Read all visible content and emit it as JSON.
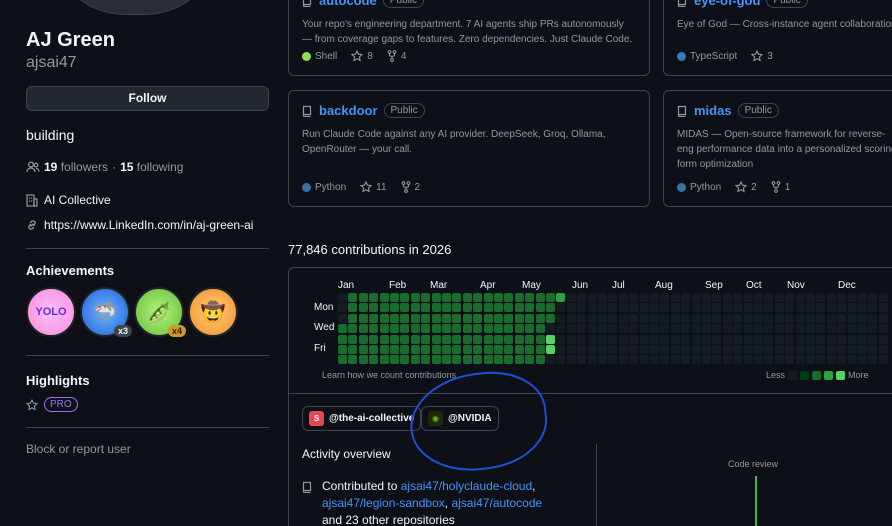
{
  "profile": {
    "name": "AJ Green",
    "login": "ajsai47",
    "follow_label": "Follow",
    "bio": "building",
    "followers_count": "19",
    "followers_label": "followers",
    "separator": "·",
    "following_count": "15",
    "following_label": "following",
    "org": "AI Collective",
    "url": "https://www.LinkedIn.com/in/aj-green-ai"
  },
  "achievements": {
    "title": "Achievements",
    "badges": [
      {
        "icon": "yolo-badge",
        "glyph": "YOLO",
        "count": ""
      },
      {
        "icon": "shark-badge",
        "glyph": "🦈",
        "count": "x3"
      },
      {
        "icon": "pair-extraordinaire-badge",
        "glyph": "🫛",
        "count": "x4"
      },
      {
        "icon": "quickdraw-badge",
        "glyph": "🤠",
        "count": ""
      }
    ]
  },
  "highlights": {
    "title": "Highlights",
    "pro": "PRO"
  },
  "block_label": "Block or report user",
  "repos": [
    {
      "name": "autocode",
      "visibility": "Public",
      "desc": "Your repo's engineering department. 7 AI agents ship PRs autonomously — from coverage gaps to features. Zero dependencies. Just Claude Code.",
      "language": "Shell",
      "lang_color": "#89e051",
      "stars": "8",
      "forks": "4"
    },
    {
      "name": "eye-of-god",
      "visibility": "Public",
      "desc": "Eye of God — Cross-instance agent collaboration",
      "language": "TypeScript",
      "lang_color": "#3178c6",
      "stars": "3",
      "forks": ""
    },
    {
      "name": "backdoor",
      "visibility": "Public",
      "desc": "Run Claude Code against any AI provider. DeepSeek, Groq, Ollama, OpenRouter — your call.",
      "language": "Python",
      "lang_color": "#3572A5",
      "stars": "11",
      "forks": "2"
    },
    {
      "name": "midas",
      "visibility": "Public",
      "desc": "MIDAS — Open-source framework for reverse-eng performance data into a personalized scoring form optimization",
      "language": "Python",
      "lang_color": "#3572A5",
      "stars": "2",
      "forks": "1"
    }
  ],
  "contributions": {
    "title": "77,846 contributions in 2026",
    "months": [
      "Jan",
      "Feb",
      "Mar",
      "Apr",
      "May",
      "Jun",
      "Jul",
      "Aug",
      "Sep",
      "Oct",
      "Nov",
      "Dec"
    ],
    "days": [
      "Mon",
      "Wed",
      "Fri"
    ],
    "learn_link": "Learn how we count contributions",
    "less": "Less",
    "more": "More",
    "filled_weeks": 20,
    "colors": {
      "empty": "#151b23",
      "l1": "#033a16",
      "l2": "#196c2e",
      "l3": "#2ea043",
      "l4": "#56d364"
    }
  },
  "orgs": [
    {
      "label": "@the-ai-collective",
      "icon": "ai-collective-logo"
    },
    {
      "label": "@NVIDIA",
      "icon": "nvidia-logo"
    }
  ],
  "activity": {
    "title": "Activity overview",
    "contributed_to": "Contributed to",
    "repo1": "ajsai47/holyclaude-cloud",
    "repo2": "ajsai47/legion-sandbox",
    "repo3": "ajsai47/autocode",
    "comma": ",",
    "others": "and 23 other repositories",
    "review_label": "Code review"
  }
}
